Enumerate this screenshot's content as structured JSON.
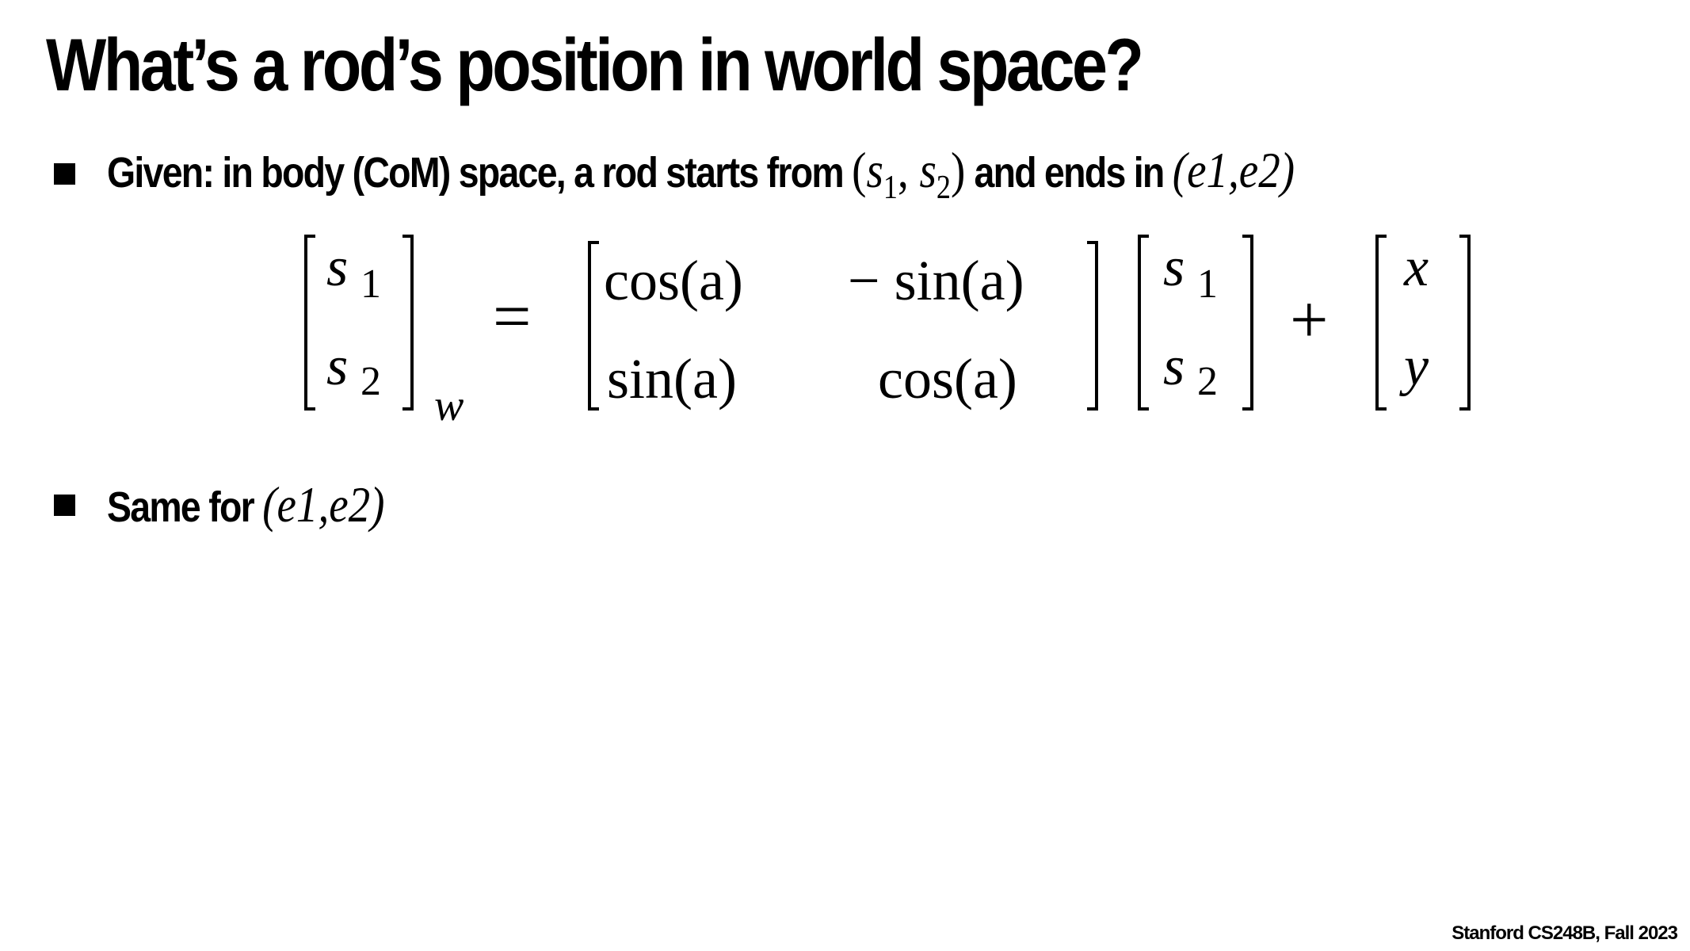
{
  "slide": {
    "title": "What’s a rod’s position in world space?",
    "bullets": [
      {
        "lead": "Given: in body (CoM) space, a rod starts from",
        "math1_open": "(",
        "math1_s": "s",
        "math1_sub1": "1",
        "math1_sep": ", ",
        "math1_s2": "s",
        "math1_sub2": "2",
        "math1_close": ")",
        "mid": " and ends in ",
        "math2": "(e1,e2)"
      },
      {
        "lead": "Same for",
        "math2": "(e1,e2)"
      }
    ],
    "equation": {
      "lhs_top": "s",
      "lhs_top_sub": "1",
      "lhs_bot": "s",
      "lhs_bot_sub": "2",
      "lhs_subscript": "w",
      "equals": "=",
      "m11": "cos(a)",
      "m12": "− sin(a)",
      "m21": "sin(a)",
      "m22": "cos(a)",
      "v_top": "s",
      "v_top_sub": "1",
      "v_bot": "s",
      "v_bot_sub": "2",
      "plus": "+",
      "t_top": "x",
      "t_bot": "y"
    },
    "footer": "Stanford CS248B, Fall 2023"
  }
}
